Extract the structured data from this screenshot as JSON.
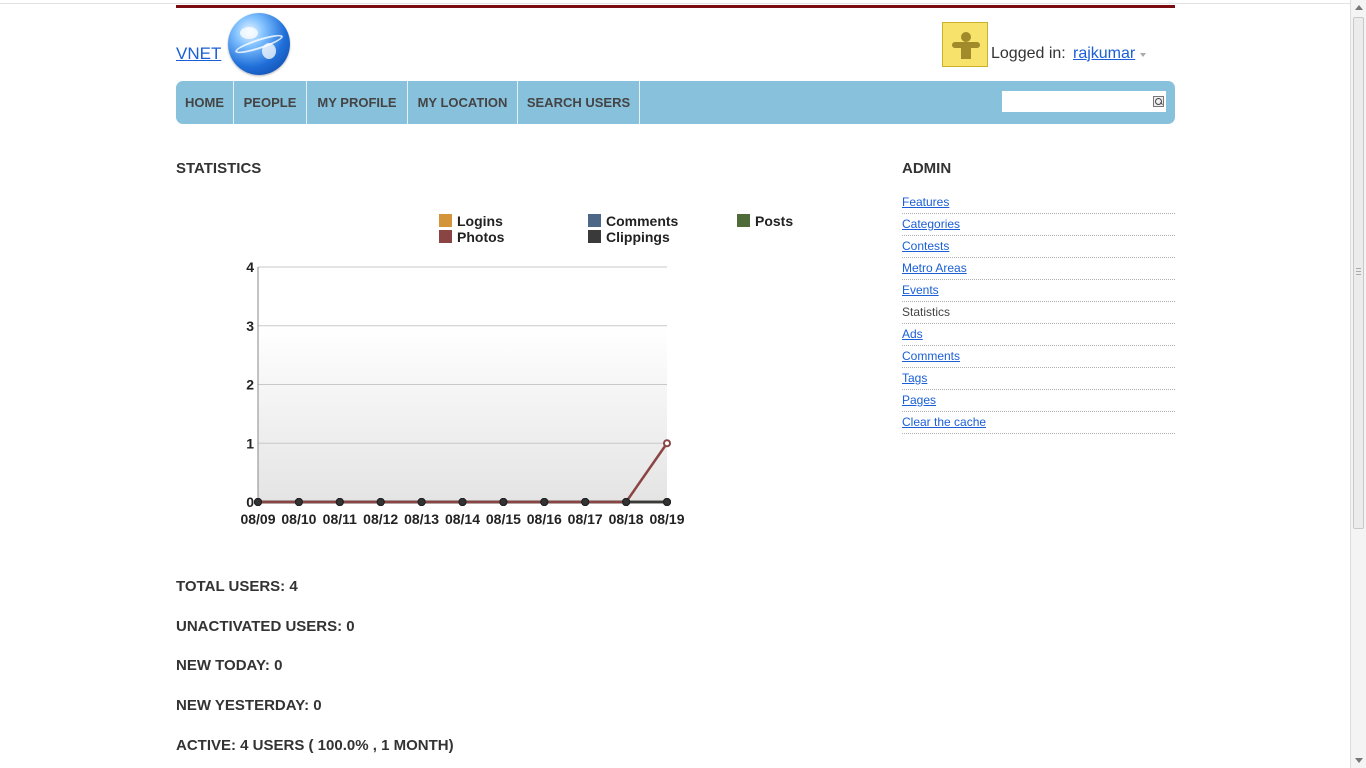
{
  "site": {
    "title": "VNET"
  },
  "user": {
    "logged_in_label": "Logged in:",
    "username": "rajkumar"
  },
  "nav": {
    "items": [
      {
        "label": "HOME"
      },
      {
        "label": "PEOPLE"
      },
      {
        "label": "MY PROFILE"
      },
      {
        "label": "MY LOCATION"
      },
      {
        "label": "SEARCH USERS"
      }
    ],
    "search": {
      "value": "",
      "placeholder": ""
    }
  },
  "stats": {
    "title": "STATISTICS",
    "lines": [
      "TOTAL USERS: 4",
      "UNACTIVATED USERS: 0",
      "NEW TODAY: 0",
      "NEW YESTERDAY: 0",
      "ACTIVE: 4 USERS ( 100.0% , 1 MONTH)"
    ]
  },
  "admin": {
    "title": "ADMIN",
    "items": [
      {
        "label": "Features",
        "link": true
      },
      {
        "label": "Categories",
        "link": true
      },
      {
        "label": "Contests",
        "link": true
      },
      {
        "label": "Metro Areas",
        "link": true
      },
      {
        "label": "Events",
        "link": true
      },
      {
        "label": "Statistics",
        "link": false
      },
      {
        "label": "Ads",
        "link": true
      },
      {
        "label": "Comments",
        "link": true
      },
      {
        "label": "Tags",
        "link": true
      },
      {
        "label": "Pages",
        "link": true
      },
      {
        "label": "Clear the cache",
        "link": true
      }
    ]
  },
  "colors": {
    "nav_bg": "#88c1dc",
    "brand_bar": "#7a0c12",
    "link": "#1a5fd6"
  },
  "chart_data": {
    "type": "line",
    "title": "",
    "xlabel": "",
    "ylabel": "",
    "categories": [
      "08/09",
      "08/10",
      "08/11",
      "08/12",
      "08/13",
      "08/14",
      "08/15",
      "08/16",
      "08/17",
      "08/18",
      "08/19"
    ],
    "ylim": [
      0,
      4
    ],
    "yticks": [
      0,
      1,
      2,
      3,
      4
    ],
    "grid": true,
    "legend_position": "top",
    "series": [
      {
        "name": "Logins",
        "color": "#d4953a",
        "values": [
          0,
          0,
          0,
          0,
          0,
          0,
          0,
          0,
          0,
          0,
          0
        ]
      },
      {
        "name": "Comments",
        "color": "#4d6786",
        "values": [
          0,
          0,
          0,
          0,
          0,
          0,
          0,
          0,
          0,
          0,
          0
        ]
      },
      {
        "name": "Posts",
        "color": "#4f6b3a",
        "values": [
          0,
          0,
          0,
          0,
          0,
          0,
          0,
          0,
          0,
          0,
          0
        ]
      },
      {
        "name": "Photos",
        "color": "#8a4444",
        "values": [
          0,
          0,
          0,
          0,
          0,
          0,
          0,
          0,
          0,
          0,
          1
        ]
      },
      {
        "name": "Clippings",
        "color": "#3a3a3a",
        "values": [
          0,
          0,
          0,
          0,
          0,
          0,
          0,
          0,
          0,
          0,
          0
        ]
      }
    ]
  }
}
